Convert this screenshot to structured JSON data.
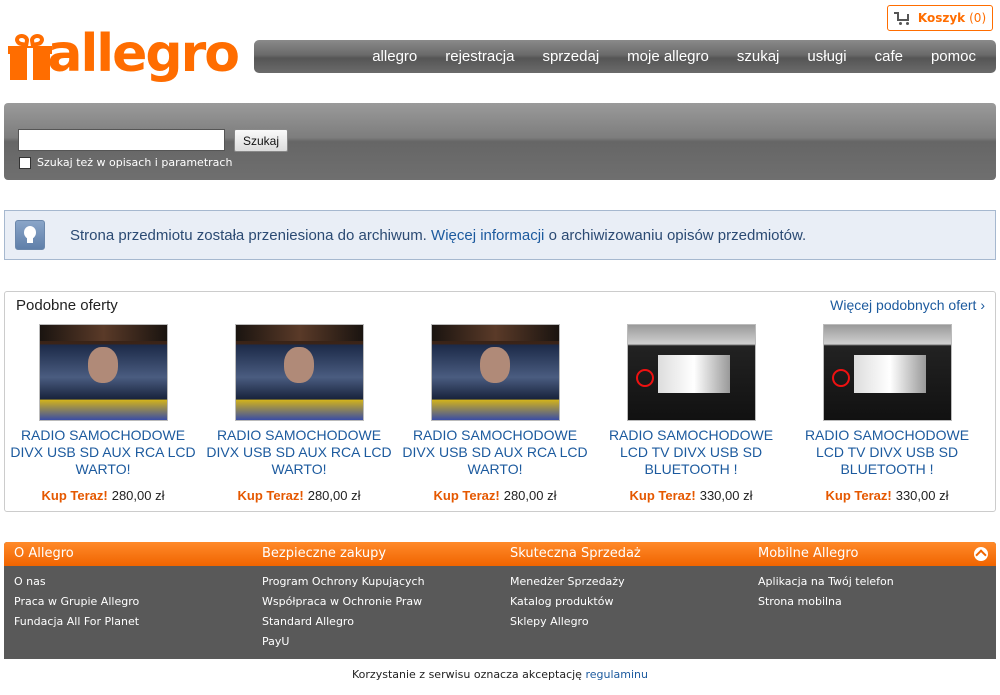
{
  "header": {
    "logo_text": "allegro",
    "cart_label": "Koszyk",
    "cart_count": "(0)",
    "nav": [
      "allegro",
      "rejestracja",
      "sprzedaj",
      "moje allegro",
      "szukaj",
      "usługi",
      "cafe",
      "pomoc"
    ]
  },
  "search": {
    "input_value": "",
    "button_label": "Szukaj",
    "checkbox_label": "Szukaj też w opisach i parametrach",
    "checkbox_checked": false
  },
  "info": {
    "text_before": "Strona przedmiotu została przeniesiona do archiwum.",
    "link": "Więcej informacji",
    "text_after": "o archiwizowaniu opisów przedmiotów."
  },
  "similar": {
    "title": "Podobne oferty",
    "more_link": "Więcej podobnych ofert ›",
    "offers": [
      {
        "title": "RADIO SAMOCHODOWE DIVX USB SD AUX RCA LCD WARTO!",
        "buy_label": "Kup Teraz!",
        "price": "280,00 zł",
        "image": "car-radio-photo"
      },
      {
        "title": "RADIO SAMOCHODOWE DIVX USB SD AUX RCA LCD WARTO!",
        "buy_label": "Kup Teraz!",
        "price": "280,00 zł",
        "image": "car-radio-photo"
      },
      {
        "title": "RADIO SAMOCHODOWE DIVX USB SD AUX RCA LCD WARTO!",
        "buy_label": "Kup Teraz!",
        "price": "280,00 zł",
        "image": "car-radio-photo"
      },
      {
        "title": "RADIO SAMOCHODOWE LCD TV DIVX USB SD BLUETOOTH !",
        "buy_label": "Kup Teraz!",
        "price": "330,00 zł",
        "image": "car-radio-photo"
      },
      {
        "title": "RADIO SAMOCHODOWE LCD TV DIVX USB SD BLUETOOTH !",
        "buy_label": "Kup Teraz!",
        "price": "330,00 zł",
        "image": "car-radio-photo"
      }
    ]
  },
  "footer": {
    "columns": [
      {
        "heading": "O Allegro",
        "links": [
          "O nas",
          "Praca w Grupie Allegro",
          "Fundacja All For Planet"
        ]
      },
      {
        "heading": "Bezpieczne zakupy",
        "links": [
          "Program Ochrony Kupujących",
          "Współpraca w Ochronie Praw",
          "Standard Allegro",
          "PayU"
        ]
      },
      {
        "heading": "Skuteczna Sprzedaż",
        "links": [
          "Menedżer Sprzedaży",
          "Katalog produktów",
          "Sklepy Allegro"
        ]
      },
      {
        "heading": "Mobilne Allegro",
        "links": [
          "Aplikacja na Twój telefon",
          "Strona mobilna"
        ]
      }
    ],
    "terms_text": "Korzystanie z serwisu oznacza akceptację",
    "terms_link": "regulaminu"
  },
  "colors": {
    "brand": "#ff6d00",
    "link": "#1c5a9e",
    "footer_bg": "#595959"
  }
}
